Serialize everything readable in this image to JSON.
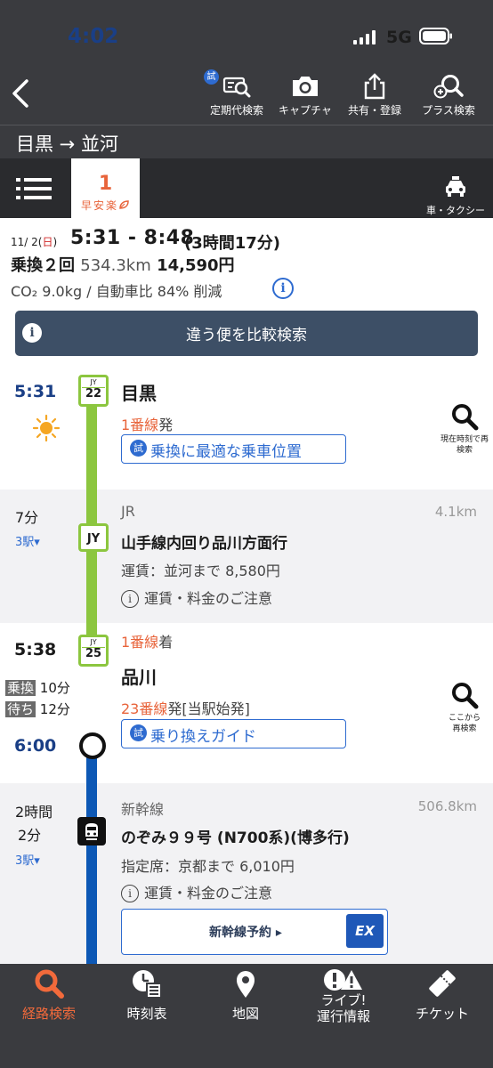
{
  "status_bar": {
    "time": "4:02",
    "network": "5G"
  },
  "toolbar": {
    "trial_badge": "試",
    "items": [
      {
        "label": "定期代検索",
        "icon": "commuter-pass-search-icon"
      },
      {
        "label": "キャプチャ",
        "icon": "camera-icon"
      },
      {
        "label": "共有・登録",
        "icon": "share-icon"
      },
      {
        "label": "プラス検索",
        "icon": "plus-search-icon"
      }
    ]
  },
  "route_title": "目黒 → 並河",
  "tabs": {
    "active_number": "1",
    "active_tags": "早安楽",
    "taxi_label": "車・タクシー"
  },
  "summary": {
    "date_prefix": "11/ 2(",
    "date_day": "日",
    "date_suffix": ")",
    "times": "5:31 - 8:48",
    "duration": "(3時間17分)",
    "transfers": "乗換２回",
    "distance": "534.3km",
    "fare": "14,590円",
    "co2": "CO₂ 9.0kg / 自動車比 84% 削減",
    "compare_button": "違う便を比較検索"
  },
  "itinerary": {
    "dep": {
      "time": "5:31",
      "line_code": "JY",
      "station_no": "22",
      "station": "目黒",
      "platform_num": "1番線",
      "platform_suffix": "発",
      "trial": "試",
      "button": "乗換に最適な乗車位置",
      "re_search": "現在時刻で再検索",
      "weather_icon": "sunny-icon"
    },
    "seg1": {
      "duration": "7分",
      "stops": "3駅▾",
      "operator": "JR",
      "km": "4.1km",
      "line_code": "JY",
      "train": "山手線内回り品川方面行",
      "fare": "運賃：並河まで 8,580円",
      "notice": "運賃・料金のご注意"
    },
    "transfer": {
      "arr_time": "5:38",
      "line_code": "JY",
      "station_no": "25",
      "arr_platform_num": "1番線",
      "arr_platform_suffix": "着",
      "station": "品川",
      "transfer_tag": "乗換",
      "transfer_min": "10分",
      "wait_tag": "待ち",
      "wait_min": "12分",
      "dep_platform_num": "23番線",
      "dep_platform_suffix": "発[当駅始発]",
      "trial": "試",
      "button": "乗り換えガイド",
      "re_search": "ここから再検索",
      "dep_time": "6:00"
    },
    "seg2": {
      "duration_line1": "2時間",
      "duration_line2": "2分",
      "stops": "3駅▾",
      "operator": "新幹線",
      "km": "506.8km",
      "train": "のぞみ９９号 (N700系)(博多行)",
      "fare": "指定席：京都まで 6,010円",
      "notice": "運賃・料金のご注意",
      "reserve_button": "新幹線予約 ▸",
      "reserve_logo": "EX"
    }
  },
  "bottom_nav": [
    {
      "label": "経路検索",
      "icon": "route-search-icon",
      "active": true
    },
    {
      "label": "時刻表",
      "icon": "timetable-icon",
      "active": false
    },
    {
      "label": "地図",
      "icon": "map-pin-icon",
      "active": false
    },
    {
      "label_line1": "ライブ!",
      "label_line2": "運行情報",
      "icon": "live-alert-icon",
      "active": false
    },
    {
      "label": "チケット",
      "icon": "ticket-icon",
      "active": false
    }
  ],
  "colors": {
    "header": "#3a3b3f",
    "accent_orange": "#e8643b",
    "yamanote_green": "#8cc63f",
    "shinkansen_blue": "#0d58b5",
    "link_blue": "#2e6bd0"
  }
}
